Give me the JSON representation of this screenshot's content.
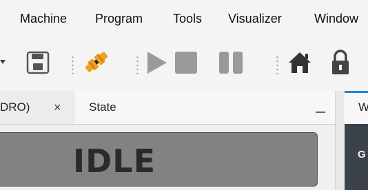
{
  "menu": {
    "items": [
      "Machine",
      "Program",
      "Tools",
      "Visualizer",
      "Window"
    ]
  },
  "toolbar": {
    "icons": [
      "dropdown-arrow-icon",
      "save-icon",
      "connect-icon",
      "play-icon",
      "stop-icon",
      "pause-icon",
      "home-icon",
      "lock-icon"
    ],
    "accent_color": "#f0a020",
    "icon_color": "#444444",
    "disabled_icon_color": "#9a9a9a"
  },
  "tabs": {
    "dro_label": "DRO)",
    "dro_close": "×",
    "state_label": "State",
    "right_label": "W",
    "right_panel_label": "G"
  },
  "state": {
    "value": "IDLE",
    "background": "#828282"
  }
}
